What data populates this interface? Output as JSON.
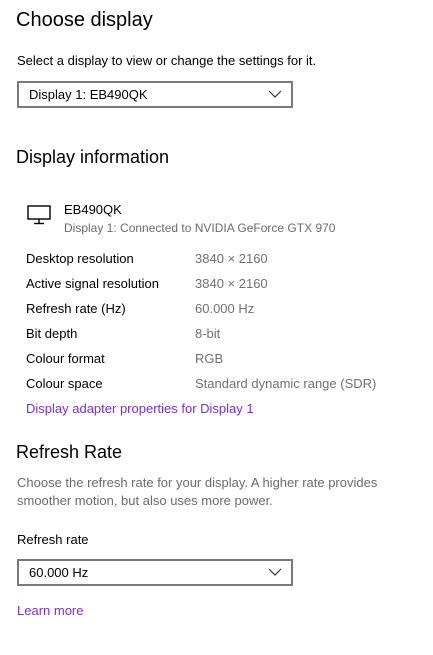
{
  "choose_display": {
    "title": "Choose display",
    "subtitle": "Select a display to view or change the settings for it.",
    "selected_display": "Display 1: EB490QK"
  },
  "display_information": {
    "title": "Display information",
    "device": {
      "name": "EB490QK",
      "connection": "Display 1: Connected to NVIDIA GeForce GTX 970",
      "icon": "monitor-icon"
    },
    "rows": [
      {
        "label": "Desktop resolution",
        "value": "3840 × 2160"
      },
      {
        "label": "Active signal resolution",
        "value": "3840 × 2160"
      },
      {
        "label": "Refresh rate (Hz)",
        "value": "60.000 Hz"
      },
      {
        "label": "Bit depth",
        "value": "8-bit"
      },
      {
        "label": "Colour format",
        "value": "RGB"
      },
      {
        "label": "Colour space",
        "value": "Standard dynamic range (SDR)"
      }
    ],
    "adapter_link": "Display adapter properties for Display 1"
  },
  "refresh_rate": {
    "title": "Refresh Rate",
    "description": "Choose the refresh rate for your display. A higher rate provides smoother motion, but also uses more power.",
    "field_label": "Refresh rate",
    "selected_rate": "60.000 Hz",
    "learn_more": "Learn more"
  },
  "colors": {
    "link": "#7c2fd6",
    "secondary_text": "#707070",
    "dropdown_border": "#7a7a7a"
  }
}
